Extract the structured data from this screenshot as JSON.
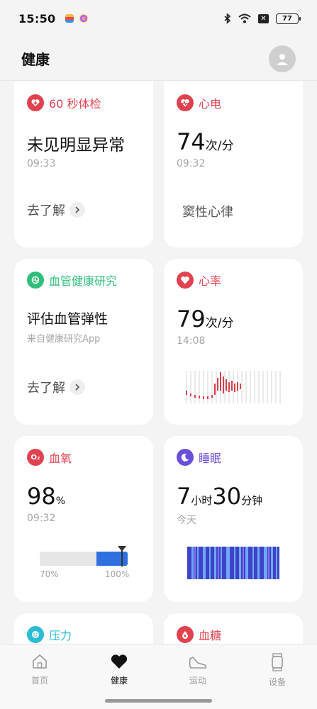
{
  "status_bar": {
    "time": "15:50",
    "battery": "77",
    "x_badge": "✕"
  },
  "header": {
    "title": "健康"
  },
  "cards": {
    "check60": {
      "title": "60 秒体检",
      "result": "未见明显异常",
      "time": "09:33",
      "link": "去了解",
      "accent": "#e0424f"
    },
    "ecg": {
      "title": "心电",
      "value": "74",
      "unit": "次/分",
      "time": "09:32",
      "result": "窦性心律",
      "accent": "#e0424f"
    },
    "vascular": {
      "title": "血管健康研究",
      "subtitle": "评估血管弹性",
      "source": "来自健康研究App",
      "link": "去了解",
      "accent": "#2fbf7a"
    },
    "heart_rate": {
      "title": "心率",
      "value": "79",
      "unit": "次/分",
      "time": "14:08",
      "accent": "#e0424f"
    },
    "spo2": {
      "title": "血氧",
      "icon_text": "O₂",
      "value": "98",
      "unit": "%",
      "time": "09:32",
      "bar_min": "70%",
      "bar_max": "100%",
      "level": 0.93,
      "accent": "#e0424f"
    },
    "sleep": {
      "title": "睡眠",
      "hours": "7",
      "hours_unit": "小时",
      "minutes": "30",
      "minutes_unit": "分钟",
      "day": "今天",
      "accent": "#6a4fd8"
    },
    "stress": {
      "title": "压力",
      "accent": "#2bbcd4"
    },
    "glucose": {
      "title": "血糖",
      "accent": "#e0424f"
    }
  },
  "bottom_nav": {
    "items": [
      {
        "label": "首页",
        "icon": "home-icon"
      },
      {
        "label": "健康",
        "icon": "heart-icon"
      },
      {
        "label": "运动",
        "icon": "shoe-icon"
      },
      {
        "label": "设备",
        "icon": "watch-icon"
      }
    ],
    "active": "健康"
  }
}
